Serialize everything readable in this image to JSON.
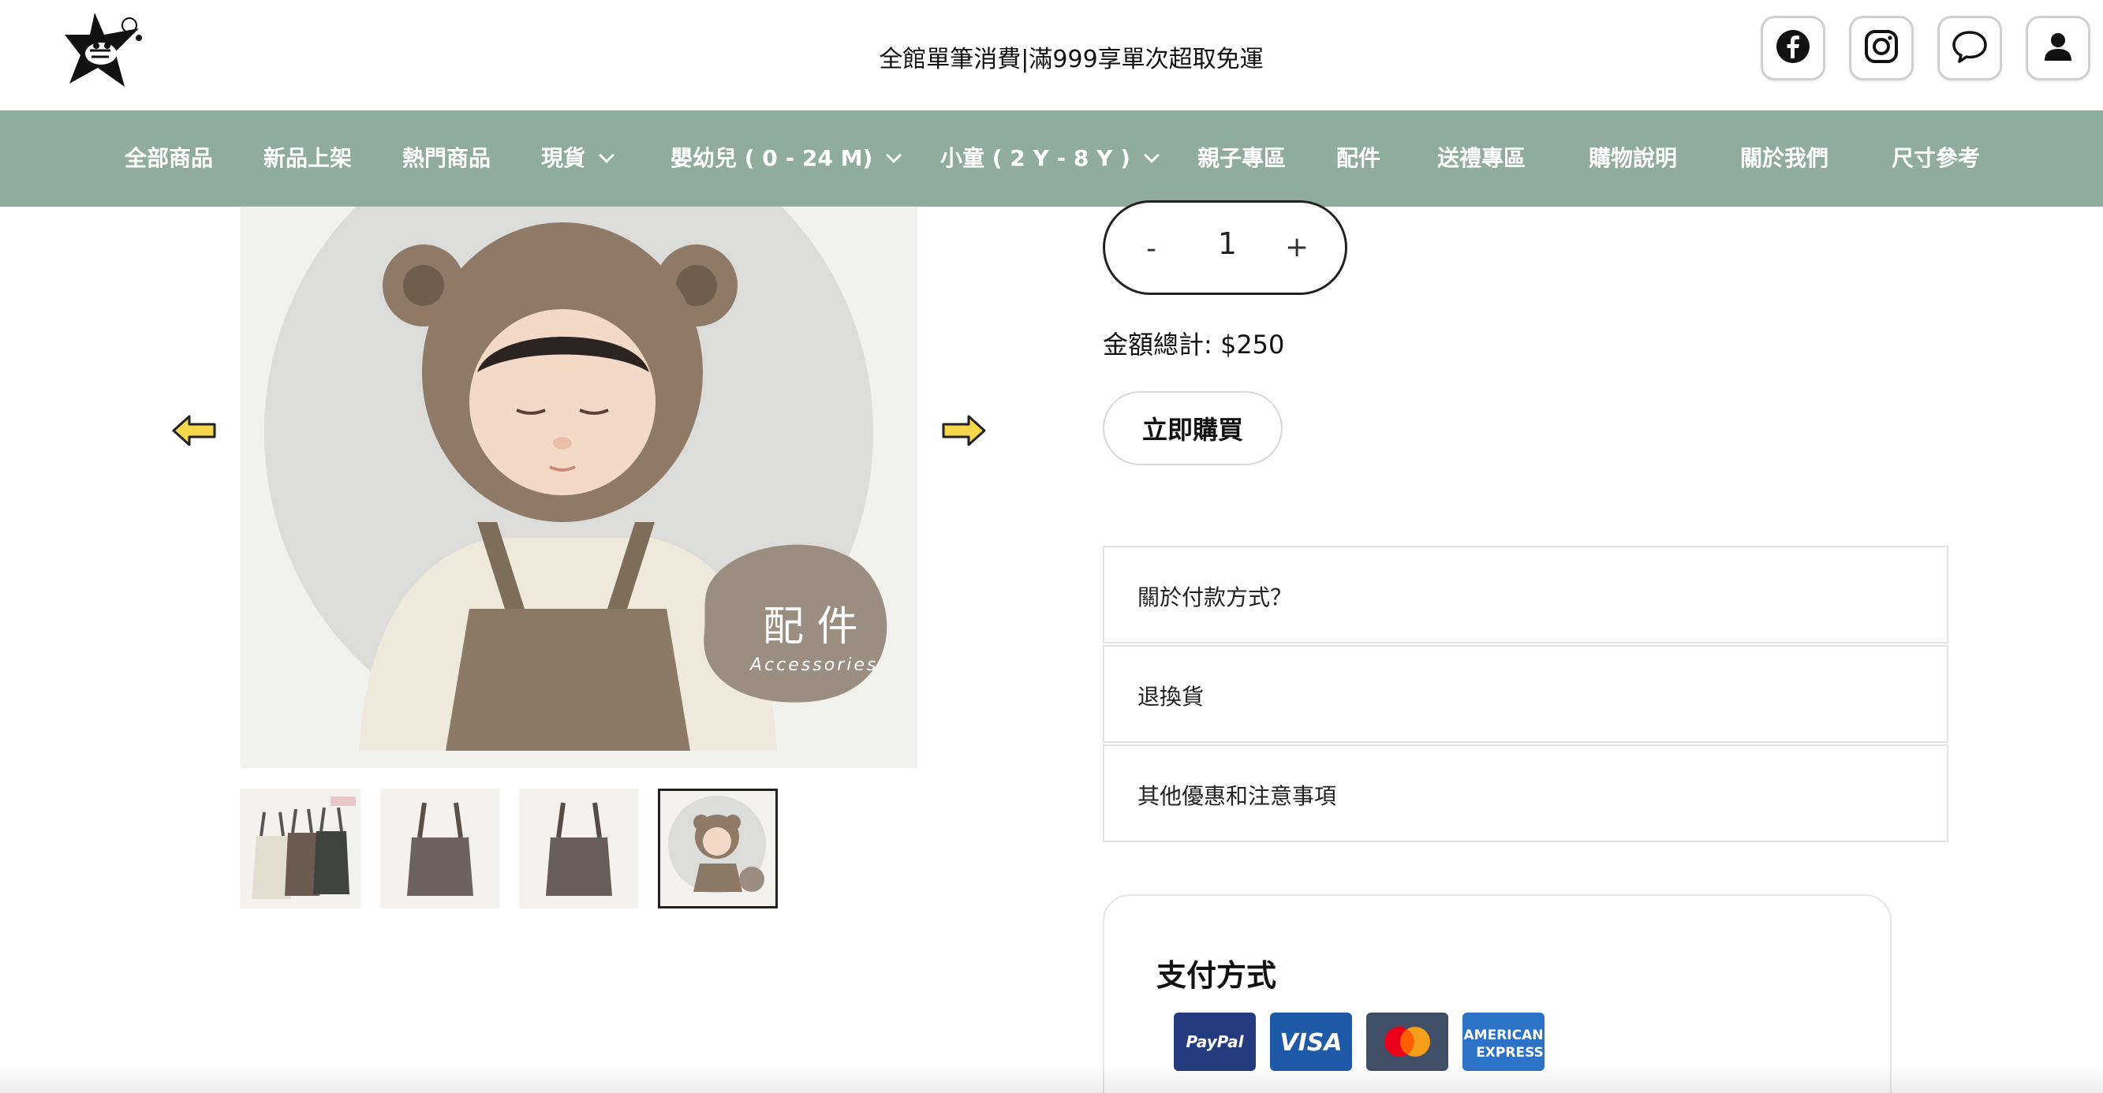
{
  "header": {
    "logo_icon": "star-bear-logo-icon",
    "announcement": "全館單筆消費|滿999享單次超取免運",
    "icons": [
      "facebook-icon",
      "instagram-icon",
      "chat-icon",
      "account-icon"
    ]
  },
  "nav": {
    "items": [
      {
        "label": "全部商品",
        "dropdown": false
      },
      {
        "label": "新品上架",
        "dropdown": false
      },
      {
        "label": "熱門商品",
        "dropdown": false
      },
      {
        "label": "現貨",
        "dropdown": true
      },
      {
        "label": "嬰幼兒 ( 0 - 24 M)",
        "dropdown": true
      },
      {
        "label": "小童 ( 2 Y - 8 Y )",
        "dropdown": true
      },
      {
        "label": "親子專區",
        "dropdown": false
      },
      {
        "label": "配件",
        "dropdown": false
      },
      {
        "label": "送禮專區",
        "dropdown": false
      },
      {
        "label": "購物說明",
        "dropdown": false
      },
      {
        "label": "關於我們",
        "dropdown": false
      },
      {
        "label": "尺寸參考",
        "dropdown": false
      }
    ],
    "background": "#8fac9c"
  },
  "gallery": {
    "badge_title": "配 件",
    "badge_subtitle": "Accessories",
    "selected_thumbnail": 4,
    "thumbnail_count": 4
  },
  "product": {
    "quantity": {
      "minus": "-",
      "value": "1",
      "plus": "+"
    },
    "total_label": "金額總計: $250",
    "buy_button": "立即購買",
    "accordion": [
      "關於付款方式？",
      "退換貨",
      "其他優惠和注意事項"
    ]
  },
  "payment": {
    "title": "支付方式",
    "paypal": "PayPal",
    "visa": "VISA",
    "amex_line1": "AMERICAN",
    "amex_line2": "EXPRESS"
  }
}
